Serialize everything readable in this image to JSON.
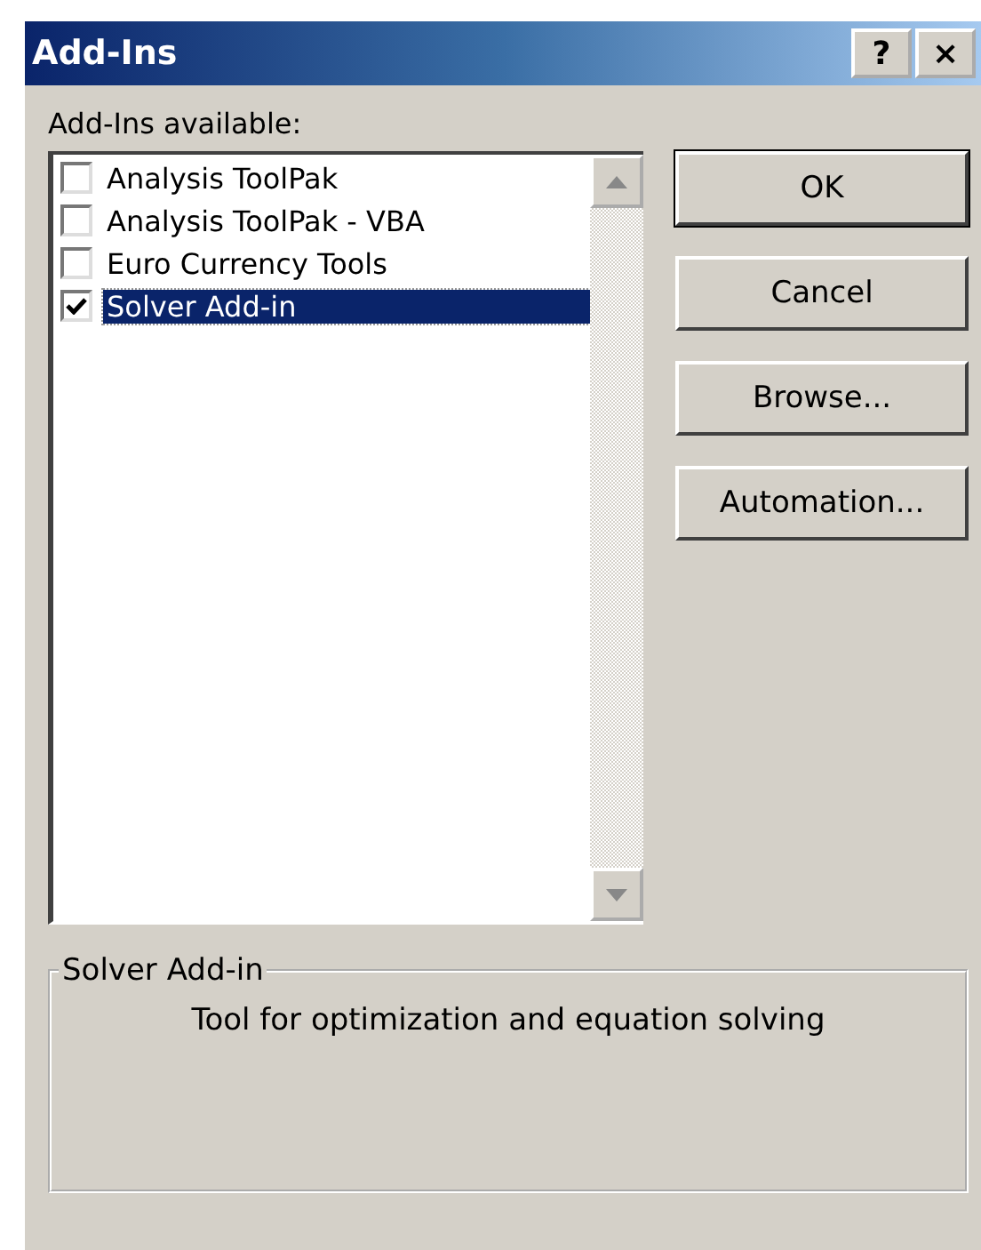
{
  "window": {
    "title": "Add-Ins",
    "title_buttons": [
      "?",
      "×"
    ]
  },
  "list": {
    "label": "Add-Ins available:",
    "items": [
      {
        "label": "Analysis ToolPak",
        "checked": false,
        "selected": false
      },
      {
        "label": "Analysis ToolPak - VBA",
        "checked": false,
        "selected": false
      },
      {
        "label": "Euro Currency Tools",
        "checked": false,
        "selected": false
      },
      {
        "label": "Solver Add-in",
        "checked": true,
        "selected": true
      }
    ]
  },
  "buttons": [
    "OK",
    "Cancel",
    "Browse...",
    "Automation..."
  ],
  "description": {
    "title": "Solver Add-in",
    "text": "Tool for optimization and equation solving"
  }
}
